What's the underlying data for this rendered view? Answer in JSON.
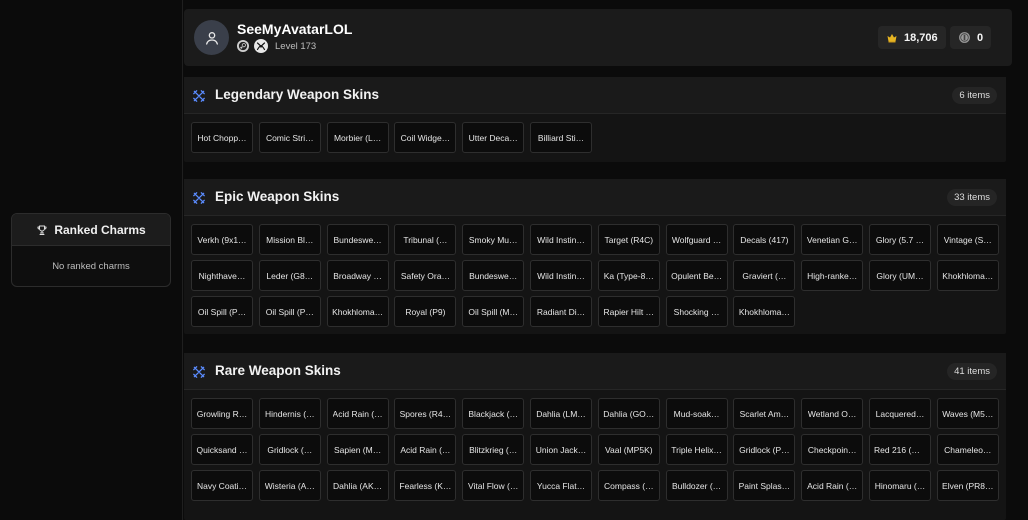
{
  "profile": {
    "username": "SeeMyAvatarLOL",
    "level": "Level 173",
    "currency_gold": "18,706",
    "currency_coins": "0",
    "icons": [
      "user-icon",
      "steam-icon",
      "xbox-icon",
      "gold-icon",
      "coin-icon"
    ]
  },
  "ranked_charms": {
    "title": "Ranked Charms",
    "empty_text": "No ranked charms"
  },
  "sections": [
    {
      "title": "Legendary Weapon Skins",
      "count": "6 items",
      "items": [
        "Hot Chopp…",
        "Comic Stri…",
        "Morbier (L…",
        "Coil Widge…",
        "Utter Deca…",
        "Billiard Sti…"
      ]
    },
    {
      "title": "Epic Weapon Skins",
      "count": "33 items",
      "items": [
        "Verkh (9x1…",
        "Mission Bl…",
        "Bundeswe…",
        "Tribunal (…",
        "Smoky Mu…",
        "Wild Instin…",
        "Target (R4C)",
        "Wolfguard …",
        "Decals (417)",
        "Venetian G…",
        "Glory (5.7 …",
        "Vintage (S…",
        "Nighthave…",
        "Leder (G8…",
        "Broadway …",
        "Safety Ora…",
        "Bundeswe…",
        "Wild Instin…",
        "Ka (Type-8…",
        "Opulent Be…",
        "Graviert (…",
        "High-ranke…",
        "Glory (UM…",
        "Khokhloma…",
        "Oil Spill (P…",
        "Oil Spill (P…",
        "Khokhloma…",
        "Royal (P9)",
        "Oil Spill (M…",
        "Radiant Di…",
        "Rapier Hilt …",
        "Shocking …",
        "Khokhloma…"
      ]
    },
    {
      "title": "Rare Weapon Skins",
      "count": "41 items",
      "items": [
        "Growling R…",
        "Hindernis (…",
        "Acid Rain (…",
        "Spores (R4…",
        "Blackjack (…",
        "Dahlia (LM…",
        "Dahlia (GO…",
        "Mud-soak…",
        "Scarlet Am…",
        "Wetland O…",
        "Lacquered…",
        "Waves (M5…",
        "Quicksand …",
        "Gridlock (…",
        "Sapien (M…",
        "Acid Rain (…",
        "Blitzkrieg (…",
        "Union Jack…",
        "Vaal (MP5K)",
        "Triple Helix…",
        "Gridlock (P…",
        "Checkpoin…",
        "Red 216 (G…",
        "Chameleo…",
        "Navy Coati…",
        "Wisteria (A…",
        "Dahlia (AK…",
        "Fearless (K…",
        "Vital Flow (…",
        "Yucca Flat…",
        "Compass (…",
        "Bulldozer (…",
        "Paint Splas…",
        "Acid Rain (…",
        "Hinomaru (…",
        "Elven (PR8…"
      ]
    }
  ]
}
